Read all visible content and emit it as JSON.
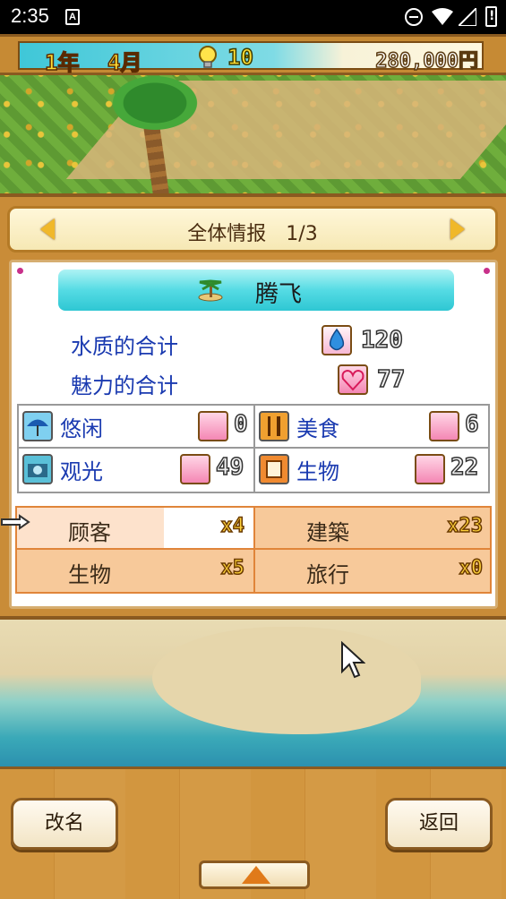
{
  "status_bar": {
    "time": "2:35",
    "notification_badge": "A"
  },
  "hud": {
    "year": "1年",
    "month": "4月",
    "points": "10",
    "money": "280,000円"
  },
  "panel": {
    "title": "全体情报　1/3",
    "name": "腾飞",
    "totals": [
      {
        "label": "水质的合计",
        "value": "120",
        "icon": "water-drop-icon"
      },
      {
        "label": "魅力的合计",
        "value": "77",
        "icon": "heart-icon"
      }
    ],
    "stats": [
      {
        "label": "悠闲",
        "value": "0",
        "icon": "umbrella-icon"
      },
      {
        "label": "美食",
        "value": "6",
        "icon": "fork-knife-icon"
      },
      {
        "label": "观光",
        "value": "49",
        "icon": "camera-icon"
      },
      {
        "label": "生物",
        "value": "22",
        "icon": "creature-icon"
      }
    ],
    "counts": [
      {
        "label": "顾客",
        "badge": "x4"
      },
      {
        "label": "建築",
        "badge": "x23"
      },
      {
        "label": "生物",
        "badge": "x5"
      },
      {
        "label": "旅行",
        "badge": "x0"
      }
    ]
  },
  "buttons": {
    "rename": "改名",
    "back": "返回"
  },
  "colors": {
    "panel_wood": "#c98c38",
    "label_blue": "#1a3ab0",
    "banner_cyan": "#2ec7d3",
    "table_orange": "#f7c99a"
  }
}
